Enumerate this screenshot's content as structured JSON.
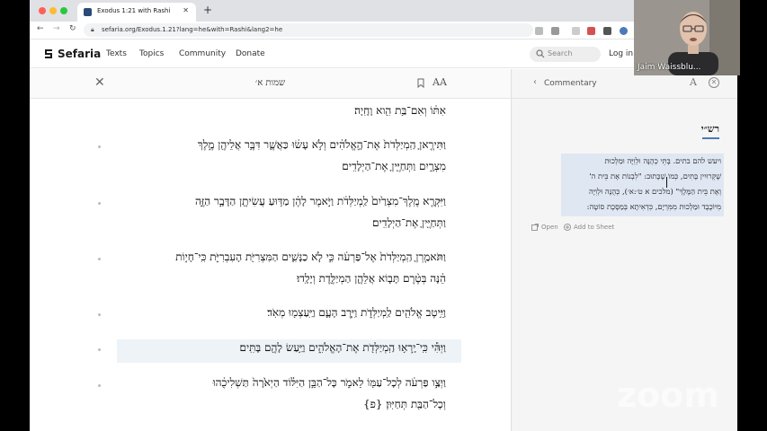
{
  "browser": {
    "tab_title": "Exodus 1:21 with Rashi",
    "url": "sefaria.org/Exodus.1.21?lang=he&with=Rashi&lang2=he"
  },
  "site": {
    "logo": "Sefaria",
    "nav": [
      "Texts",
      "Topics",
      "Community",
      "Donate"
    ],
    "search_placeholder": "Search",
    "login": "Log in"
  },
  "reader": {
    "title": "שמות א׳",
    "font_toggle": "AA",
    "verses": [
      {
        "num": "",
        "lines": [
          "אִתּ֔וֹ וְאִם־בַּ֥ת הִ֖וא וָחָֽיָה׃"
        ]
      },
      {
        "num": "יז",
        "lines": [
          "וַתִּירֶ֤אןָ הַֽמְיַלְּדֹת֙ אֶת־הָ֣אֱלֹהִ֔ים וְלֹ֣א עָשׂ֔וּ כַּאֲשֶׁ֛ר דִּבֶּ֥ר אֲלֵיהֶ֖ן מֶ֣לֶךְ",
          "מִצְרָ֑יִם וַתְּחַיֶּ֖יןָ אֶת־הַיְלָדִֽים׃"
        ]
      },
      {
        "num": "יח",
        "lines": [
          "וַיִּקְרָ֤א מֶֽלֶךְ־מִצְרַ֙יִם֙ לַֽמְיַלְּדֹ֔ת וַיֹּ֣אמֶר לָהֶ֔ן מַדּ֥וּעַ עֲשִׂיתֶ֖ן הַדָּבָ֣ר הַזֶּ֑ה",
          "וַתְּחַיֶּ֖יןָ אֶת־הַיְלָדִֽים׃"
        ]
      },
      {
        "num": "יט",
        "lines": [
          "וַתֹּאמַ֤רְןָ הַֽמְיַלְּדֹת֙ אֶל־פַּרְעֹ֔ה כִּ֣י לֹ֧א כַנָּשִׁ֛ים הַמִּצְרִיֹּ֖ת הָעִבְרִיֹּ֑ת כִּֽי־חָי֣וֹת",
          "הֵ֔נָּה בְּטֶ֨רֶם תָּב֧וֹא אֲלֵהֶ֛ן הַמְיַלֶּ֖דֶת וְיָלָֽדוּ׃"
        ]
      },
      {
        "num": "כ",
        "lines": [
          "וַיֵּ֥יטֶב אֱלֹהִ֖ים לַֽמְיַלְּדֹ֑ת וַיִּ֧רֶב הָעָ֛ם וַיַּֽעַצְמ֖וּ מְאֹֽד׃"
        ]
      },
      {
        "num": "כא",
        "lines": [
          "וַיְהִ֕י כִּֽי־יָֽרְא֥וּ הַֽמְיַלְּדֹ֖ת אֶת־הָאֱלֹהִ֑ים וַיַּ֥עַשׂ לָהֶ֖ם בָּתִּֽים׃"
        ]
      },
      {
        "num": "כב",
        "lines": [
          "וַיְצַ֣ו פַּרְעֹ֔ה לְכָל־עַמּ֖וֹ לֵאמֹ֑ר כָּל־הַבֵּ֣ן הַיִּלּ֗וֹד הַיְאֹ֙רָה֙ תַּשְׁלִיכֻ֔הוּ",
          "וְכָל־הַבַּ֖ת תְּחַיּֽוּן׃ {פ}"
        ]
      }
    ]
  },
  "commentary": {
    "header": "Commentary",
    "font_toggle": "A",
    "source": "רש״י",
    "lines": [
      "ויעש להם בתים. בָּתֵּי כְהֻנָּה וּלְוִיָּה וּמַלְכוּת",
      "שֶׁקְּרוּיִין בָּתִּים, כְּמוֹ שֶׁכָּתוּב: \"לִבְנוֹת אֶת בֵּית ה'",
      "וְאֶת בֵּית הַמֶּלֶךְ\" (מלכים א ט׳:א׳), כְּהֻנָּה וּלְוִיָּה",
      "מִיּוֹכֶבֶד וּמַלְכוּת מִמִּרְיָם, כִּדְאִיתָא בְּמַסֶּכֶת סוֹטָה:"
    ],
    "open": "Open",
    "add_to_sheet": "Add to Sheet"
  },
  "webcam": {
    "name": "Jaim Waissblu..."
  },
  "overlay": {
    "watermark": "zoom"
  }
}
